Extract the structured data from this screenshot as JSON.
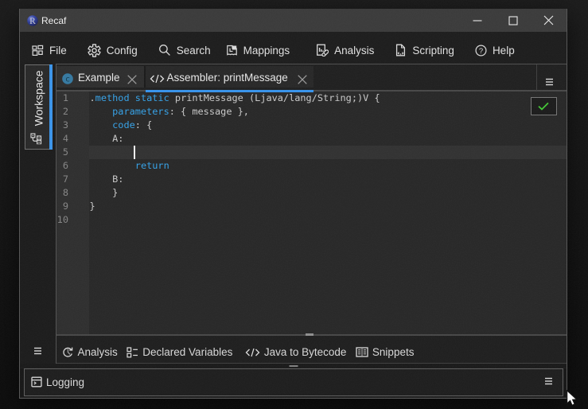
{
  "window": {
    "title": "Recaf",
    "controls": {
      "minimize": "minimize",
      "maximize": "maximize",
      "close": "close"
    }
  },
  "menubar": {
    "items": [
      {
        "label": "File",
        "icon": "file-menu-icon"
      },
      {
        "label": "Config",
        "icon": "gear-icon"
      },
      {
        "label": "Search",
        "icon": "search-icon"
      },
      {
        "label": "Mappings",
        "icon": "mappings-icon"
      },
      {
        "label": "Analysis",
        "icon": "analysis-icon"
      },
      {
        "label": "Scripting",
        "icon": "scripting-icon"
      },
      {
        "label": "Help",
        "icon": "help-icon"
      }
    ]
  },
  "sidebar": {
    "workspace_tab": {
      "label": "Workspace",
      "icon": "workspace-tree-icon",
      "active": true
    }
  },
  "tabs": [
    {
      "label": "Example",
      "icon": "class-icon",
      "close": "close-icon",
      "active": false
    },
    {
      "label": "Assembler: printMessage",
      "icon": "code-tag-icon",
      "close": "close-icon",
      "active": true
    }
  ],
  "editor": {
    "status": "assemble-success",
    "caret": {
      "line": 5,
      "column": 8
    },
    "lines": [
      {
        "n": 1,
        "segments": [
          [
            "p",
            "."
          ],
          [
            "k",
            "method"
          ],
          [
            "p",
            " "
          ],
          [
            "k",
            "static"
          ],
          [
            "p",
            " printMessage (Ljava/lang/String;)V {"
          ]
        ]
      },
      {
        "n": 2,
        "segments": [
          [
            "p",
            "    "
          ],
          [
            "k",
            "parameters"
          ],
          [
            "p",
            ": { message },"
          ]
        ]
      },
      {
        "n": 3,
        "segments": [
          [
            "p",
            "    "
          ],
          [
            "k",
            "code"
          ],
          [
            "p",
            ": {"
          ]
        ]
      },
      {
        "n": 4,
        "segments": [
          [
            "p",
            "    A:"
          ]
        ]
      },
      {
        "n": 5,
        "segments": []
      },
      {
        "n": 6,
        "segments": [
          [
            "p",
            "        "
          ],
          [
            "k",
            "return"
          ]
        ]
      },
      {
        "n": 7,
        "segments": [
          [
            "p",
            "    B:"
          ]
        ]
      },
      {
        "n": 8,
        "segments": [
          [
            "p",
            "    }"
          ]
        ]
      },
      {
        "n": 9,
        "segments": [
          [
            "p",
            "}"
          ]
        ]
      },
      {
        "n": 10,
        "segments": []
      }
    ]
  },
  "bottom_toolbar": {
    "items": [
      {
        "label": "Analysis",
        "icon": "history-clock-icon"
      },
      {
        "label": "Declared Variables",
        "icon": "checklist-icon"
      },
      {
        "label": "Java to Bytecode",
        "icon": "code-tag-icon"
      },
      {
        "label": "Snippets",
        "icon": "book-icon"
      }
    ]
  },
  "logging": {
    "label": "Logging",
    "icon": "terminal-window-icon"
  },
  "colors": {
    "accent_blue": "#3a94ea",
    "keyword_blue": "#35a2e8",
    "success_green": "#43c935",
    "class_teal": "#3579a1"
  }
}
